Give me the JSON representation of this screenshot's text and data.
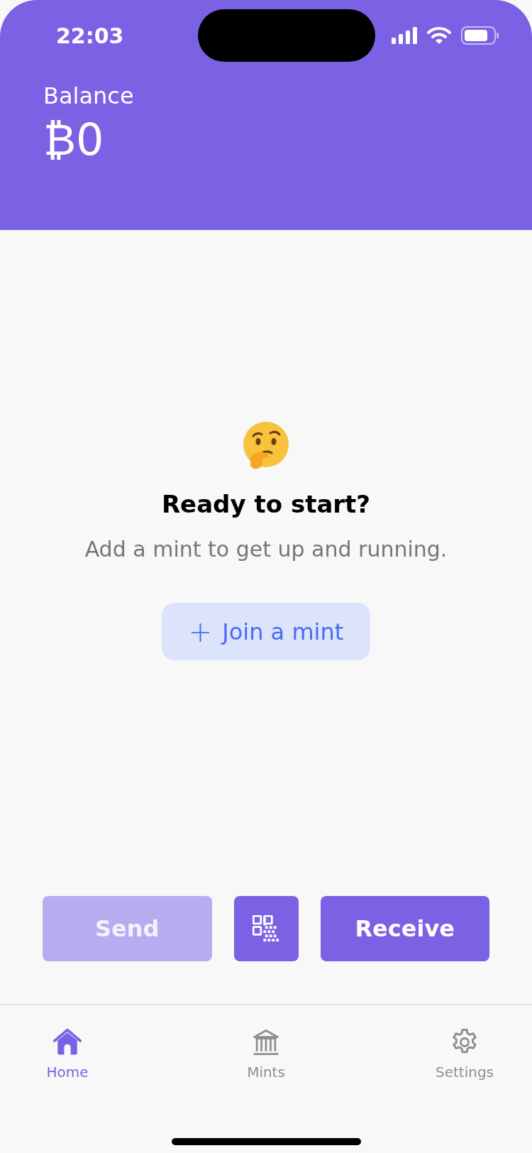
{
  "status_bar": {
    "time": "22:03"
  },
  "header": {
    "label": "Balance",
    "amount": "₿0"
  },
  "empty_state": {
    "title": "Ready to start?",
    "message": "Add a mint to get up and running.",
    "button": {
      "icon": "+",
      "label": "Join a mint"
    }
  },
  "actions": [
    {
      "kind": "text",
      "label": "Send",
      "disabled": true
    },
    {
      "kind": "qr",
      "disabled": false
    },
    {
      "kind": "text",
      "label": "Receive",
      "disabled": false
    }
  ],
  "tabs": [
    {
      "kind": "home",
      "label": "Home",
      "selected": true
    },
    {
      "kind": "bank",
      "label": "Mints",
      "selected": false
    },
    {
      "kind": "gear",
      "label": "Settings",
      "selected": false
    }
  ]
}
